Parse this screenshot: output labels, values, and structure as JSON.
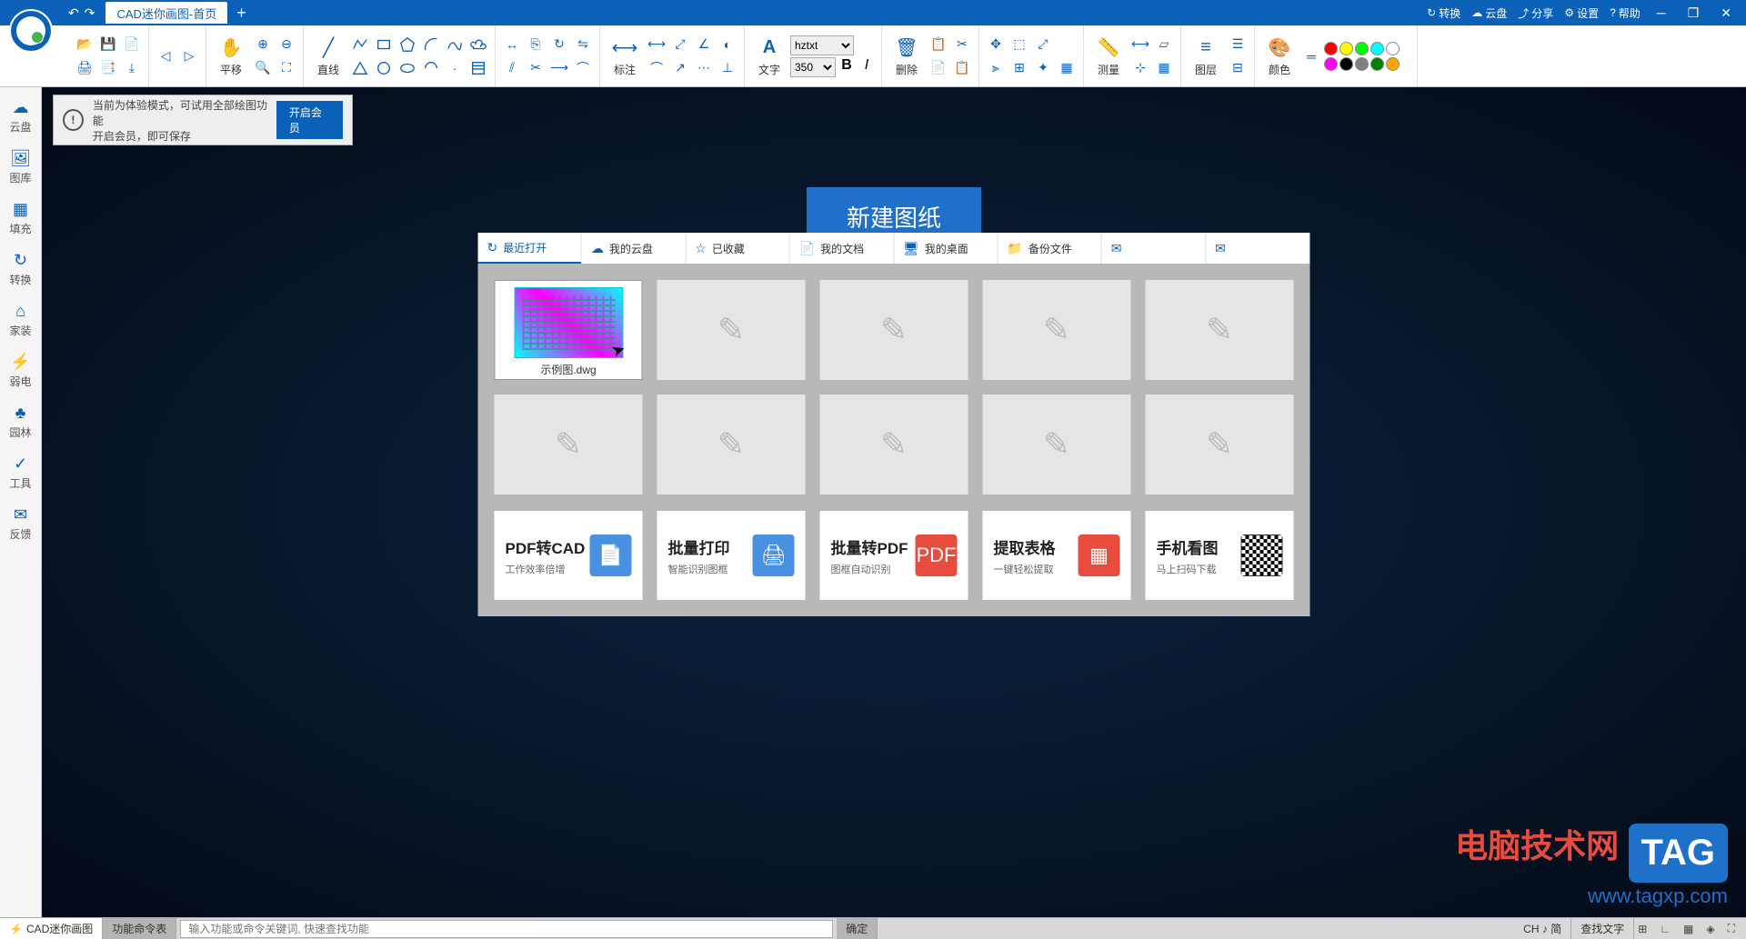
{
  "title": {
    "tab": "CAD迷你画图-首页"
  },
  "titleRight": {
    "convert": "转换",
    "cloud": "云盘",
    "share": "分享",
    "settings": "设置",
    "help": "帮助"
  },
  "ribbon": {
    "pan": "平移",
    "line": "直线",
    "dimension": "标注",
    "text": "文字",
    "font": "hztxt",
    "fontSize": "350",
    "delete": "删除",
    "measure": "测量",
    "layer": "图层",
    "color": "颜色"
  },
  "colors": [
    "#ff0000",
    "#ffff00",
    "#00ff00",
    "#00ffff",
    "#ffffff",
    "#ff00ff",
    "#000000",
    "#808080",
    "#008000",
    "#ffa500"
  ],
  "sidebar": [
    {
      "icon": "☁",
      "label": "云盘"
    },
    {
      "icon": "🖼",
      "label": "图库"
    },
    {
      "icon": "▦",
      "label": "填充"
    },
    {
      "icon": "↻",
      "label": "转换"
    },
    {
      "icon": "⌂",
      "label": "家装"
    },
    {
      "icon": "⚡",
      "label": "弱电"
    },
    {
      "icon": "♣",
      "label": "园林"
    },
    {
      "icon": "✓",
      "label": "工具"
    },
    {
      "icon": "✉",
      "label": "反馈"
    }
  ],
  "notification": {
    "line1": "当前为体验模式，可试用全部绘图功能",
    "line2": "开启会员，即可保存",
    "button": "开启会员"
  },
  "newDrawing": "新建图纸",
  "panelTabs": [
    {
      "icon": "↻",
      "label": "最近打开",
      "active": true
    },
    {
      "icon": "☁",
      "label": "我的云盘"
    },
    {
      "icon": "☆",
      "label": "已收藏"
    },
    {
      "icon": "📄",
      "label": "我的文档"
    },
    {
      "icon": "🖥",
      "label": "我的桌面"
    },
    {
      "icon": "📁",
      "label": "备份文件"
    },
    {
      "icon": "✉",
      "label": ""
    },
    {
      "icon": "✉",
      "label": ""
    }
  ],
  "files": [
    {
      "name": "示例图.dwg"
    }
  ],
  "features": [
    {
      "t1": "PDF转CAD",
      "t2": "工作效率倍增",
      "iconClass": "",
      "icon": "📄"
    },
    {
      "t1": "批量打印",
      "t2": "智能识别图框",
      "iconClass": "",
      "icon": "🖨"
    },
    {
      "t1": "批量转PDF",
      "t2": "图框自动识别",
      "iconClass": "red",
      "icon": "PDF"
    },
    {
      "t1": "提取表格",
      "t2": "一键轻松提取",
      "iconClass": "red",
      "icon": "▦"
    },
    {
      "t1": "手机看图",
      "t2": "马上扫码下载",
      "iconClass": "qr",
      "icon": ""
    }
  ],
  "watermark": {
    "text": "电脑技术网",
    "tag": "TAG",
    "url": "www.tagxp.com"
  },
  "statusbar": {
    "app": "CAD迷你画图",
    "cmdList": "功能命令表",
    "inputPlaceholder": "输入功能或命令关键词, 快速查找功能",
    "confirm": "确定",
    "ime": "CH ♪ 简",
    "search": "查找文字"
  }
}
